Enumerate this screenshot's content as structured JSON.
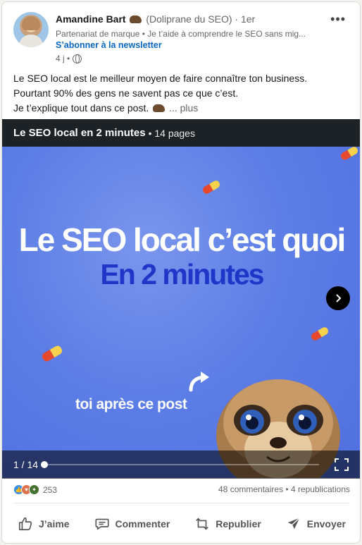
{
  "author": {
    "name": "Amandine Bart",
    "brand": "(Doliprane du SEO)",
    "degree": "· 1er",
    "headline": "Partenariat de marque • Je t’aide à comprendre le SEO sans mig...",
    "subscribe_label": "S’abonner à la newsletter",
    "time": "4 j •"
  },
  "more_label": "•••",
  "post": {
    "line1": "Le SEO local est le meilleur moyen de faire connaître ton business.",
    "line2": "Pourtant 90% des gens ne savent pas ce que c’est.",
    "line3": "Je t’explique tout dans ce post.",
    "see_more": "... plus"
  },
  "document": {
    "title": "Le SEO local en 2 minutes",
    "pages_label": "• 14 pages",
    "slide_title": "Le SEO local c’est quoi",
    "slide_subtitle": "En 2 minutes",
    "slide_caption": "toi après ce post",
    "page_indicator": "1 / 14",
    "progress": 0.0
  },
  "social": {
    "reaction_count": "253",
    "comments_reposts": "48 commentaires • 4 republications"
  },
  "actions": [
    {
      "label": "J’aime",
      "icon": "thumbs-up-icon"
    },
    {
      "label": "Commenter",
      "icon": "comment-icon"
    },
    {
      "label": "Republier",
      "icon": "repost-icon"
    },
    {
      "label": "Envoyer",
      "icon": "send-icon"
    }
  ],
  "colors": {
    "accent": "#0a66c2",
    "slide_bg": "#5d7ee6",
    "slide_subtitle": "#1f36c9",
    "titlebar": "#1d2226"
  }
}
